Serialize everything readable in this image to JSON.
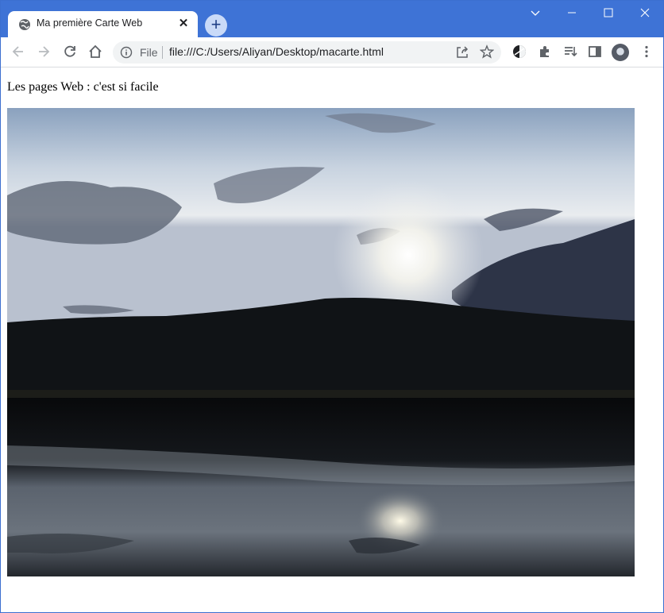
{
  "browser": {
    "tab": {
      "title": "Ma première Carte Web"
    },
    "omnibox": {
      "scheme_label": "File",
      "url": "file:///C:/Users/Aliyan/Desktop/macarte.html"
    }
  },
  "page": {
    "heading": "Les pages Web : c'est si facile",
    "image": {
      "alt": "Coucher de soleil sur un lac"
    }
  },
  "colors": {
    "tabstrip": "#3e73d6",
    "accent_new_tab": "#c9daf8"
  }
}
